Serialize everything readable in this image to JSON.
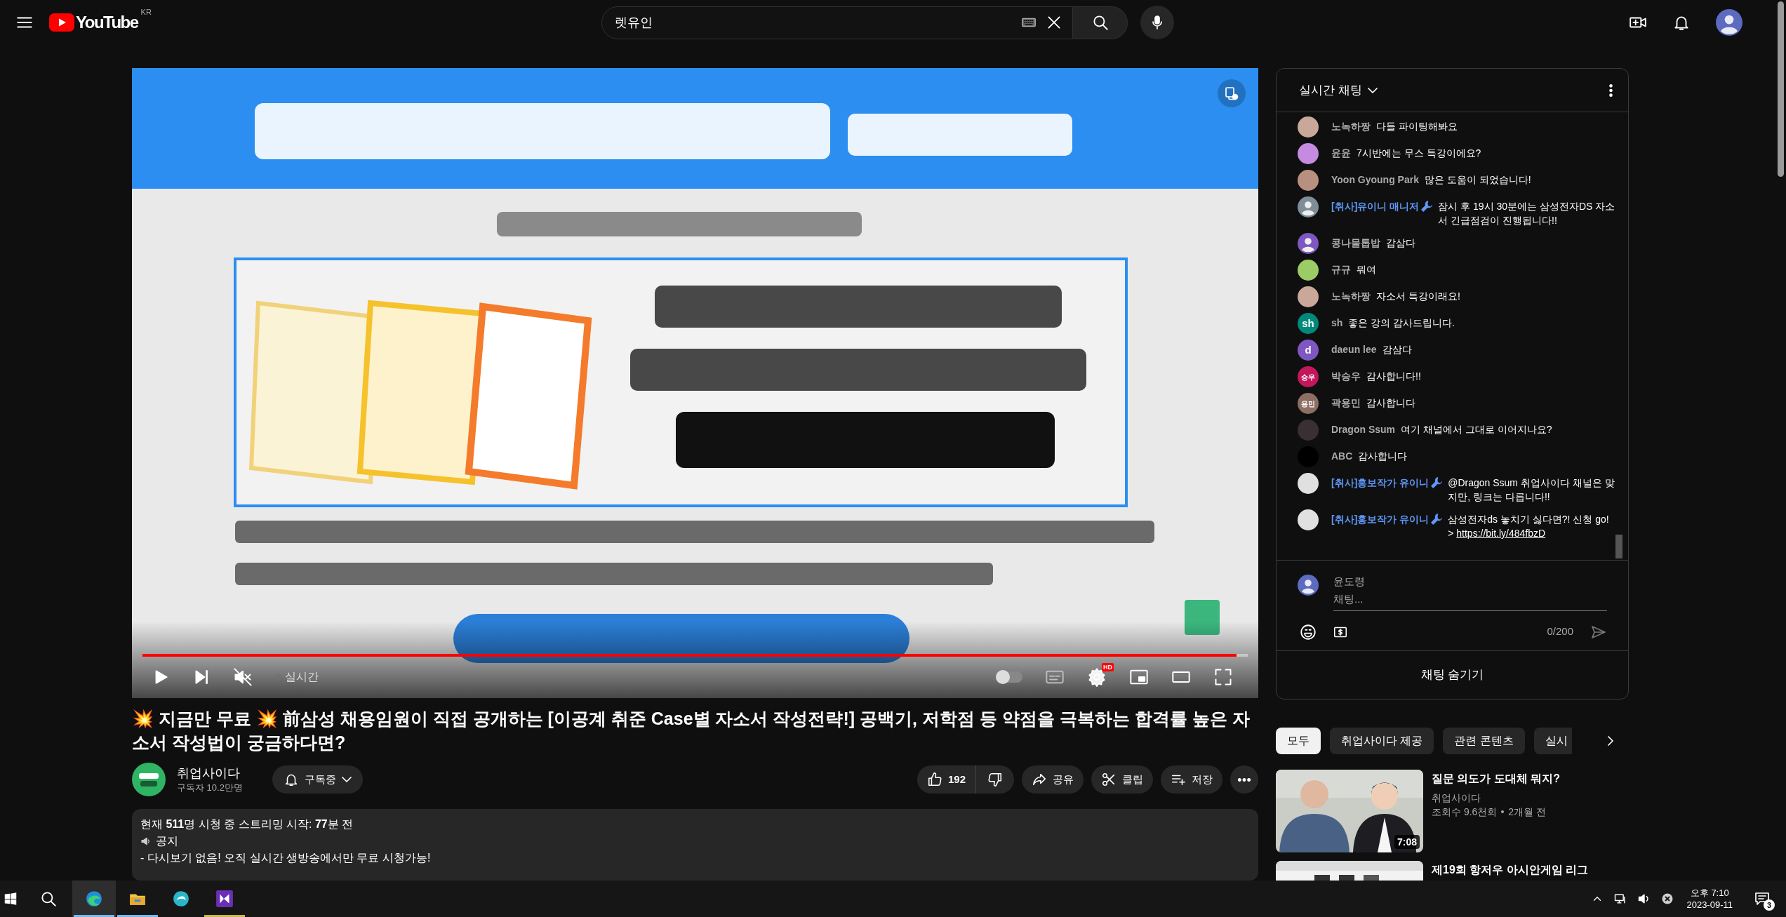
{
  "header": {
    "logo": "YouTube",
    "region": "KR",
    "search": {
      "value": "렛유인"
    }
  },
  "video": {
    "kind": "picture",
    "muted": true,
    "autoplay": false,
    "live_label": "실시간",
    "quality_badge": "HD",
    "level": 0.99
  },
  "title": "💥 지금만 무료 💥  前삼성 채용임원이 직접 공개하는 [이공계 취준 Case별 자소서 작성전략!] 공백기, 저학점 등 약점을 극복하는 합격률 높은 자소서 작성법이 궁금하다면?",
  "channel": {
    "name": "취업사이다",
    "subscribers": "구독자 10.2만명",
    "subscribe_label": "구독중"
  },
  "actions": {
    "likes": "192",
    "share": "공유",
    "clip": "클립",
    "save": "저장"
  },
  "description": {
    "stats": "현재 **511**명 시청 중  스트리밍 시작: **77**분 전",
    "notice": "공지",
    "body": "- 다시보기 없음! 오직 실시간 생방송에서만 무료 시청가능!"
  },
  "chat": {
    "title": "실시간 채팅",
    "messages": [
      {
        "author": "노녹하짱",
        "text": "다들 파이팅해봐요",
        "moderator": false,
        "kind": "plain",
        "color": "#c9a89a"
      },
      {
        "author": "윤윤",
        "text": "7시반에는 무스 특강이에요?",
        "moderator": false,
        "kind": "plain",
        "color": "#c58be0"
      },
      {
        "author": "Yoon Gyoung Park",
        "text": "많은 도움이 되었습니다!",
        "moderator": false,
        "kind": "plain",
        "color": "#b89080"
      },
      {
        "author": "[취사]유이니 매니저",
        "text": "잠시 후 19시 30분에는 삼성전자DS 자소서 긴급점검이 진행됩니다!!",
        "moderator": true,
        "kind": "silhouette",
        "color": "#7d8e99"
      },
      {
        "author": "콩나물톱밥",
        "text": "감삼다",
        "moderator": false,
        "kind": "silhouette",
        "color": "#7e57c2"
      },
      {
        "author": "규규",
        "text": "뭐여",
        "moderator": false,
        "kind": "plain",
        "color": "#9ccc65"
      },
      {
        "author": "노녹하짱",
        "text": "자소서 특강이래요!",
        "moderator": false,
        "kind": "plain",
        "color": "#c9a89a"
      },
      {
        "author": "sh",
        "text": "좋은 강의 감사드립니다.",
        "moderator": false,
        "kind": "letters",
        "avatar_text": "sh",
        "color": "#00897b"
      },
      {
        "author": "daeun lee",
        "text": "감삼다",
        "moderator": false,
        "kind": "letters",
        "avatar_text": "d",
        "color": "#7e57c2"
      },
      {
        "author": "박승우",
        "text": "감사합니다!!",
        "moderator": false,
        "kind": "letters",
        "avatar_text": "승우",
        "color": "#c2185b"
      },
      {
        "author": "곽용민",
        "text": "감사합니다",
        "moderator": false,
        "kind": "letters",
        "avatar_text": "용민",
        "color": "#8d6e63"
      },
      {
        "author": "Dragon Ssum",
        "text": "여기 채널에서 그대로 이어지나요?",
        "moderator": false,
        "kind": "plain",
        "color": "#3a2f33"
      },
      {
        "author": "ABC",
        "text": "감사합니다",
        "moderator": false,
        "kind": "plain",
        "color": "#000000"
      },
      {
        "author": "[취사]홍보작가 유이니",
        "text": "@Dragon Ssum 취업사이다 채널은 맞지만, 링크는 다릅니다!!",
        "moderator": true,
        "kind": "plain",
        "color": "#e0e0e0"
      },
      {
        "author": "[취사]홍보작가 유이니",
        "text": "삼성전자ds 놓치기 싫다면?! 신청 go! >",
        "link": "https://bit.ly/484fbzD",
        "moderator": true,
        "kind": "plain",
        "color": "#e0e0e0"
      }
    ],
    "input": {
      "user": "윤도령",
      "placeholder": "채팅...",
      "counter": "0/200"
    },
    "hide_label": "채팅 숨기기"
  },
  "chips": [
    {
      "label": "모두",
      "selected": true
    },
    {
      "label": "취업사이다 제공",
      "selected": false
    },
    {
      "label": "관련 콘텐츠",
      "selected": false
    },
    {
      "label": "실시",
      "selected": false
    }
  ],
  "recommended": [
    {
      "title": "질문 의도가 도대체 뭐지?",
      "channel": "취업사이다",
      "views": "조회수 9.6천회",
      "age": "2개월 전",
      "duration": "7:08",
      "kind": "people"
    },
    {
      "title": "제19회 항저우 아시안게임 리그",
      "kind": "banner"
    }
  ],
  "taskbar": {
    "apps": [
      {
        "kind": "browser",
        "selected": true,
        "running": true
      },
      {
        "kind": "folder",
        "selected": false,
        "running": true
      },
      {
        "kind": "swirl",
        "selected": false,
        "running": false
      },
      {
        "kind": "studio",
        "selected": false,
        "running": true
      }
    ],
    "time": "오후 7:10",
    "date": "2023-09-11",
    "notifications": "3"
  }
}
